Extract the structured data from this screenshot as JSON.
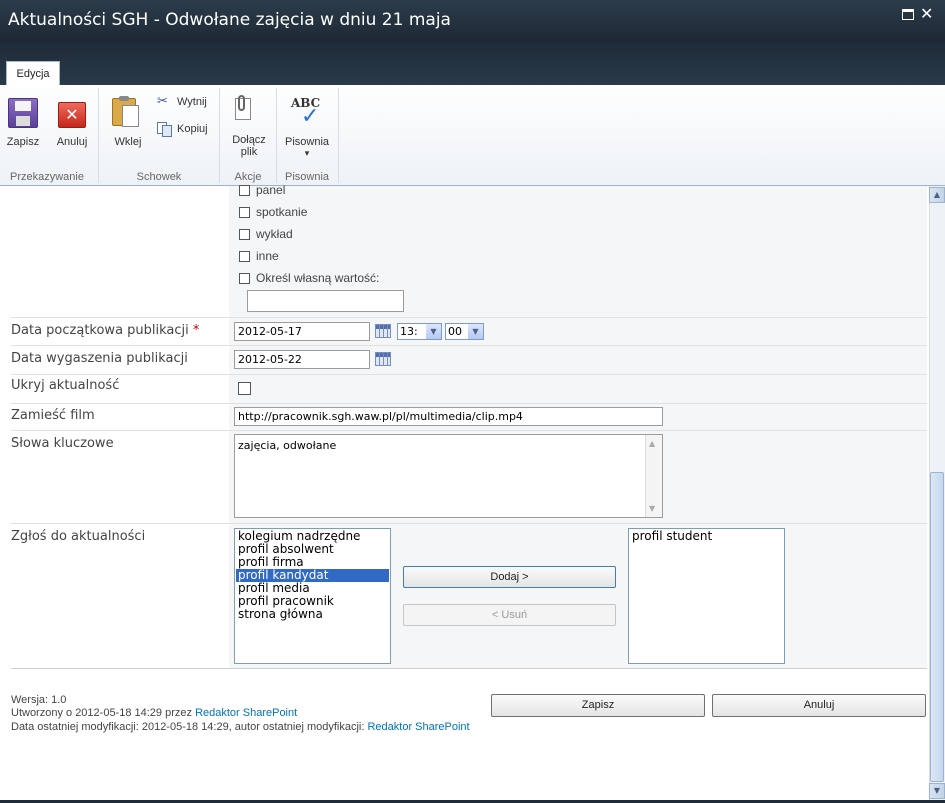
{
  "window": {
    "title": "Aktualności SGH - Odwołane zajęcia w dniu 21 maja"
  },
  "ribbon": {
    "tab": "Edycja",
    "groups": {
      "commit": {
        "label": "Przekazywanie",
        "save": "Zapisz",
        "cancel": "Anuluj"
      },
      "clipboard": {
        "label": "Schowek",
        "paste": "Wklej",
        "cut": "Wytnij",
        "copy": "Kopiuj"
      },
      "actions": {
        "label": "Akcje",
        "attach_line1": "Dołącz",
        "attach_line2": "plik"
      },
      "spelling": {
        "label": "Pisownia",
        "spelling": "Pisownia",
        "spelling_arrow": "▾",
        "abc": "ABC"
      }
    }
  },
  "form": {
    "choices": [
      "panel",
      "spotkanie",
      "wykład",
      "inne"
    ],
    "custom_choice": {
      "label": "Określ własną wartość:",
      "value": ""
    },
    "start_date": {
      "label": "Data początkowa publikacji",
      "required": "*",
      "value": "2012-05-17",
      "hour": "13:",
      "minute": "00"
    },
    "end_date": {
      "label": "Data wygaszenia publikacji",
      "value": "2012-05-22"
    },
    "hide": {
      "label": "Ukryj aktualność",
      "checked": false
    },
    "video": {
      "label": "Zamieść film",
      "value": "http://pracownik.sgh.waw.pl/pl/multimedia/clip.mp4"
    },
    "keywords": {
      "label": "Słowa kluczowe",
      "value": "zajęcia, odwołane"
    },
    "submit_to": {
      "label": "Zgłoś do aktualności",
      "available": [
        "kolegium nadrzędne",
        "profil absolwent",
        "profil firma",
        "profil kandydat",
        "profil media",
        "profil pracownik",
        "strona główna"
      ],
      "selected_index": 3,
      "chosen": [
        "profil student"
      ],
      "add_label": "Dodaj >",
      "remove_label": "< Usuń"
    }
  },
  "footer": {
    "version": "Wersja: 1.0",
    "created_prefix": "Utworzony o 2012-05-18 14:29 przez",
    "created_by": "Redaktor SharePoint",
    "modified_prefix": "Data ostatniej modyfikacji: 2012-05-18 14:29, autor ostatniej modyfikacji:",
    "modified_by": "Redaktor SharePoint",
    "save": "Zapisz",
    "cancel": "Anuluj"
  },
  "colors": {
    "titlebar": "#22303e",
    "link": "#0072bc",
    "selection": "#316ac5",
    "required": "#cc0000"
  }
}
